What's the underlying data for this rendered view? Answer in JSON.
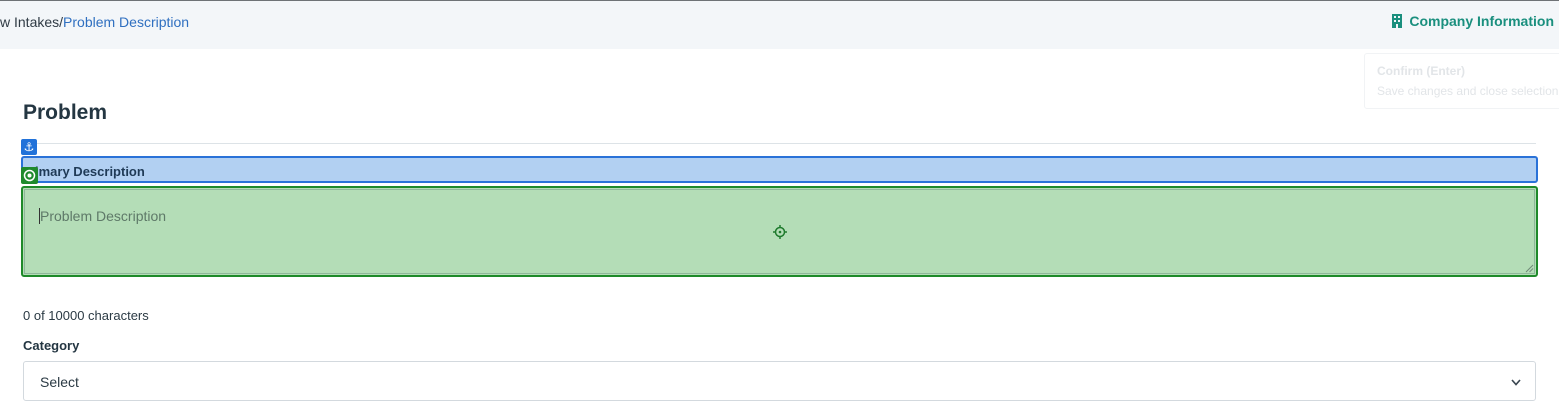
{
  "breadcrumb": {
    "parent": "w Intakes",
    "separator": "/",
    "current": "Problem Description"
  },
  "header": {
    "company_link": "Company Information",
    "company_icon": "building-icon"
  },
  "tooltip": {
    "title": "Confirm (Enter)",
    "description": "Save changes and close selection v"
  },
  "section": {
    "title": "Problem"
  },
  "field": {
    "label": "imary Description",
    "placeholder": "Problem Description",
    "char_count": "0 of 10000 characters"
  },
  "category": {
    "label": "Category",
    "value": "Select"
  },
  "colors": {
    "accent_blue": "#2f6fc0",
    "accent_teal": "#1a8f7e",
    "highlight_blue": "#b2d0f2",
    "highlight_green": "#b4ddb7"
  }
}
